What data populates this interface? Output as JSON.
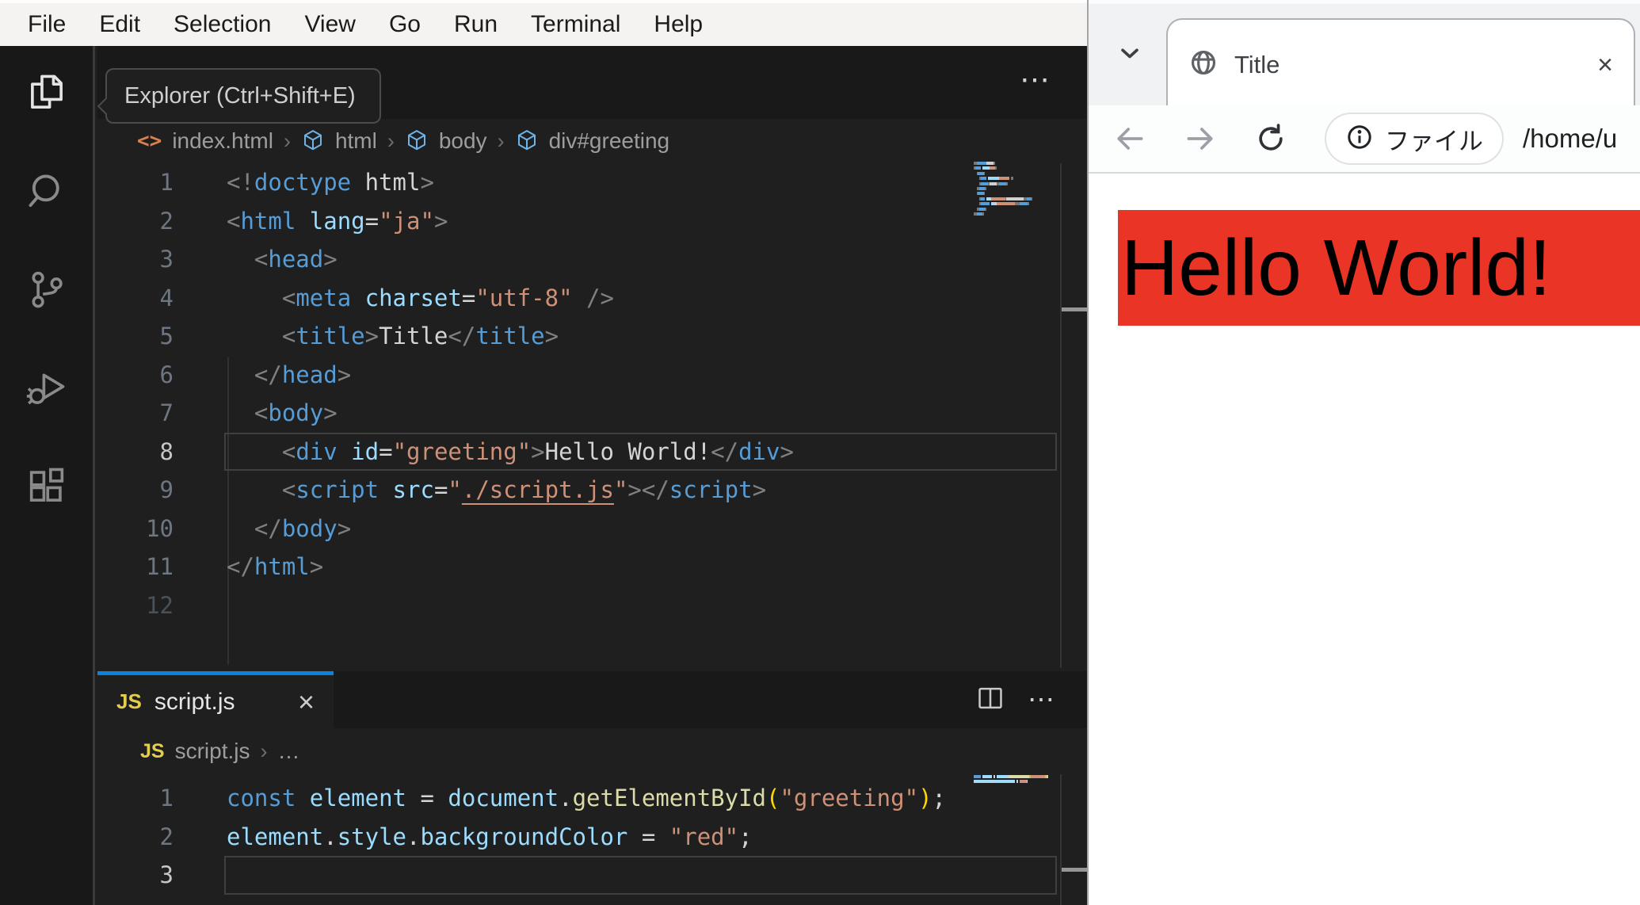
{
  "colors": {
    "active_tab_accent": "#0c82dd",
    "page_red": "#ea3425",
    "editor_background": "#1f1f1f",
    "menu_background": "#f4f3f1"
  },
  "vscode": {
    "sep": "›",
    "menu": {
      "items": [
        "File",
        "Edit",
        "Selection",
        "View",
        "Go",
        "Run",
        "Terminal",
        "Help"
      ]
    },
    "activity_bar": {
      "icons": [
        "explorer",
        "search",
        "source-control",
        "run-and-debug",
        "extensions"
      ]
    },
    "tooltip": {
      "text": "Explorer (Ctrl+Shift+E)"
    },
    "html_editor": {
      "actions": {
        "more": "⋯"
      },
      "breadcrumb": {
        "file": "index.html",
        "node1": "html",
        "node2": "body",
        "node3": "div#greeting"
      },
      "code": {
        "current_line": 8,
        "lines": [
          {
            "n": "1",
            "tokens": [
              [
                "<!",
                "p"
              ],
              [
                "doctype",
                "t"
              ],
              [
                " html",
                "w"
              ],
              [
                ">",
                "p"
              ]
            ]
          },
          {
            "n": "2",
            "tokens": [
              [
                "<",
                "p"
              ],
              [
                "html",
                "t"
              ],
              [
                " ",
                "w"
              ],
              [
                "lang",
                "a"
              ],
              [
                "=",
                "w"
              ],
              [
                "\"ja\"",
                "s"
              ],
              [
                ">",
                "p"
              ]
            ]
          },
          {
            "n": "3",
            "tokens": [
              [
                "  ",
                "w"
              ],
              [
                "<",
                "p"
              ],
              [
                "head",
                "t"
              ],
              [
                ">",
                "p"
              ]
            ]
          },
          {
            "n": "4",
            "tokens": [
              [
                "    ",
                "w"
              ],
              [
                "<",
                "p"
              ],
              [
                "meta",
                "t"
              ],
              [
                " ",
                "w"
              ],
              [
                "charset",
                "a"
              ],
              [
                "=",
                "w"
              ],
              [
                "\"utf-8\"",
                "s"
              ],
              [
                " ",
                "w"
              ],
              [
                "/>",
                "p"
              ]
            ]
          },
          {
            "n": "5",
            "tokens": [
              [
                "    ",
                "w"
              ],
              [
                "<",
                "p"
              ],
              [
                "title",
                "t"
              ],
              [
                ">",
                "p"
              ],
              [
                "Title",
                "w"
              ],
              [
                "</",
                "p"
              ],
              [
                "title",
                "t"
              ],
              [
                ">",
                "p"
              ]
            ]
          },
          {
            "n": "6",
            "tokens": [
              [
                "  ",
                "w"
              ],
              [
                "</",
                "p"
              ],
              [
                "head",
                "t"
              ],
              [
                ">",
                "p"
              ]
            ]
          },
          {
            "n": "7",
            "tokens": [
              [
                "  ",
                "w"
              ],
              [
                "<",
                "p"
              ],
              [
                "body",
                "t"
              ],
              [
                ">",
                "p"
              ]
            ]
          },
          {
            "n": "8",
            "tokens": [
              [
                "    ",
                "w"
              ],
              [
                "<",
                "p"
              ],
              [
                "div",
                "t"
              ],
              [
                " ",
                "w"
              ],
              [
                "id",
                "a"
              ],
              [
                "=",
                "w"
              ],
              [
                "\"greeting\"",
                "s"
              ],
              [
                ">",
                "p"
              ],
              [
                "Hello World!",
                "w"
              ],
              [
                "</",
                "p"
              ],
              [
                "div",
                "t"
              ],
              [
                ">",
                "p"
              ]
            ]
          },
          {
            "n": "9",
            "tokens": [
              [
                "    ",
                "w"
              ],
              [
                "<",
                "p"
              ],
              [
                "script",
                "t"
              ],
              [
                " ",
                "w"
              ],
              [
                "src",
                "a"
              ],
              [
                "=",
                "w"
              ],
              [
                "\"",
                "s"
              ],
              [
                "./script.js",
                "su"
              ],
              [
                "\"",
                "s"
              ],
              [
                ">",
                "p"
              ],
              [
                "</",
                "p"
              ],
              [
                "script",
                "t"
              ],
              [
                ">",
                "p"
              ]
            ]
          },
          {
            "n": "10",
            "tokens": [
              [
                "  ",
                "w"
              ],
              [
                "</",
                "p"
              ],
              [
                "body",
                "t"
              ],
              [
                ">",
                "p"
              ]
            ]
          },
          {
            "n": "11",
            "tokens": [
              [
                "</",
                "p"
              ],
              [
                "html",
                "t"
              ],
              [
                ">",
                "p"
              ]
            ]
          },
          {
            "n": "12",
            "dim": true,
            "tokens": []
          }
        ]
      }
    },
    "js_editor": {
      "tab": {
        "icon": "JS",
        "label": "script.js",
        "close": "×"
      },
      "actions": {
        "split": "split-editor",
        "more": "⋯"
      },
      "breadcrumb": {
        "icon": "JS",
        "file": "script.js",
        "more": "…"
      },
      "code": {
        "current_line": 3,
        "lines": [
          {
            "n": "1",
            "tokens": [
              [
                "const",
                "t"
              ],
              [
                " ",
                "w"
              ],
              [
                "element",
                "a"
              ],
              [
                " ",
                "w"
              ],
              [
                "=",
                "w"
              ],
              [
                " ",
                "w"
              ],
              [
                "document",
                "a"
              ],
              [
                ".",
                "w"
              ],
              [
                "getElementById",
                "y"
              ],
              [
                "(",
                "b"
              ],
              [
                "\"greeting\"",
                "s"
              ],
              [
                ")",
                "b"
              ],
              [
                ";",
                "w"
              ]
            ]
          },
          {
            "n": "2",
            "tokens": [
              [
                "element",
                "a"
              ],
              [
                ".",
                "w"
              ],
              [
                "style",
                "a"
              ],
              [
                ".",
                "w"
              ],
              [
                "backgroundColor",
                "a"
              ],
              [
                " ",
                "w"
              ],
              [
                "=",
                "w"
              ],
              [
                " ",
                "w"
              ],
              [
                "\"red\"",
                "s"
              ],
              [
                ";",
                "w"
              ]
            ]
          },
          {
            "n": "3",
            "tokens": []
          }
        ]
      }
    }
  },
  "browser": {
    "tab": {
      "title": "Title",
      "close": "×"
    },
    "toolbar": {
      "file_chip": "ファイル",
      "url": "/home/u"
    },
    "page": {
      "greeting": "Hello World!"
    }
  }
}
